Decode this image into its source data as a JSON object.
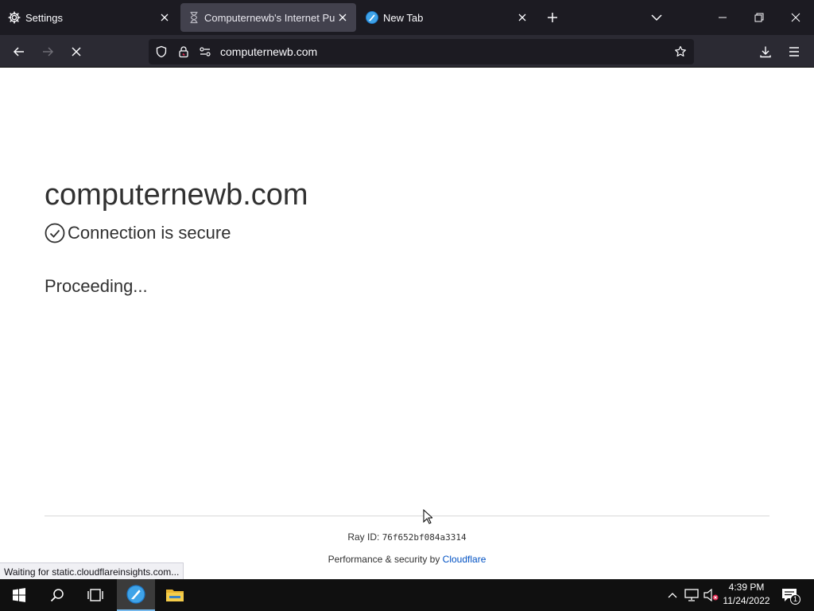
{
  "tabs": [
    {
      "label": "Settings",
      "icon": "gear-icon"
    },
    {
      "label": "Computernewb's Internet Pub",
      "icon": "hourglass-icon",
      "active": true
    },
    {
      "label": "New Tab",
      "icon": "browser-logo-icon"
    }
  ],
  "urlbar": {
    "value": "computernewb.com"
  },
  "page": {
    "site_title": "computernewb.com",
    "secure_text": "Connection is secure",
    "proceeding": "Proceeding...",
    "ray_label": "Ray ID:",
    "ray_id": "76f652bf084a3314",
    "perf_prefix": "Performance & security by",
    "perf_link": "Cloudflare"
  },
  "status": "Waiting for static.cloudflareinsights.com...",
  "taskbar": {
    "time": "4:39 PM",
    "date": "11/24/2022",
    "notification_count": "1"
  },
  "colors": {
    "chrome_dark": "#1c1b22",
    "toolbar": "#2b2a33",
    "link": "#0051c3",
    "text": "#313131"
  }
}
